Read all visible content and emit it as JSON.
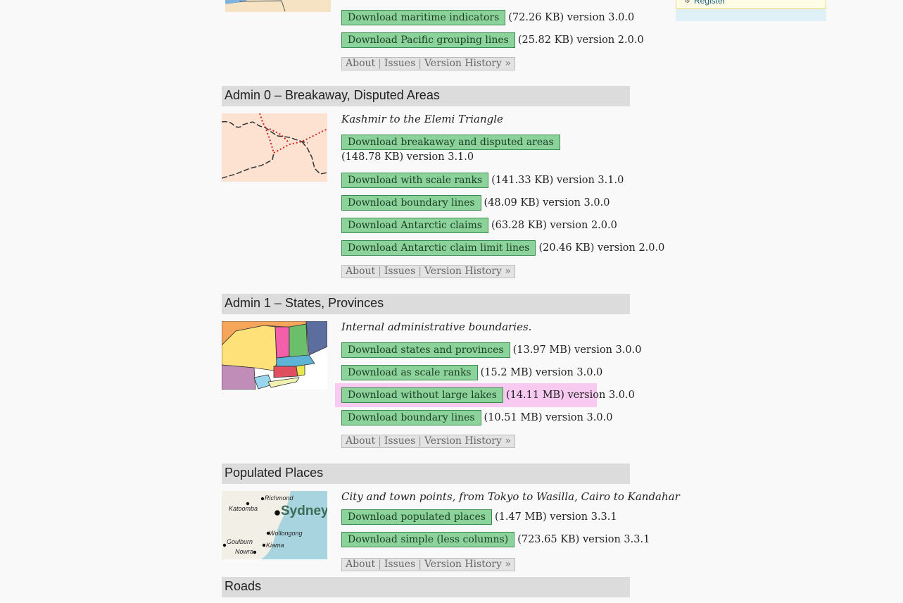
{
  "sidebar": {
    "register_label": "Register"
  },
  "top_block": {
    "rows": [
      {
        "button": "Download maritime indicators",
        "meta": "(72.26 KB) version 3.0.0"
      },
      {
        "button": "Download Pacific grouping lines",
        "meta": "(25.82 KB) version 2.0.0"
      }
    ]
  },
  "links": {
    "about": "About",
    "issues": "Issues",
    "version_history": "Version History »"
  },
  "sections": [
    {
      "title": "Admin 0 – Breakaway, Disputed Areas",
      "description": "Kashmir to the Elemi Triangle",
      "rows": [
        {
          "button": "Download breakaway and disputed areas",
          "meta": "(148.78 KB) version 3.1.0"
        },
        {
          "button": "Download with scale ranks",
          "meta": "(141.33 KB) version 3.1.0"
        },
        {
          "button": "Download boundary lines",
          "meta": "(48.09 KB) version 3.0.0"
        },
        {
          "button": "Download Antarctic claims",
          "meta": "(63.28 KB) version 2.0.0"
        },
        {
          "button": "Download Antarctic claim limit lines",
          "meta": "(20.46 KB) version 2.0.0"
        }
      ]
    },
    {
      "title": "Admin 1 – States, Provinces",
      "description": "Internal administrative boundaries.",
      "rows": [
        {
          "button": "Download states and provinces",
          "meta": "(13.97 MB) version 3.0.0"
        },
        {
          "button": "Download as scale ranks",
          "meta": "(15.2 MB) version 3.0.0"
        },
        {
          "button": "Download without large lakes",
          "meta": "(14.11 MB) version 3.0.0"
        },
        {
          "button": "Download boundary lines",
          "meta": "(10.51 MB) version 3.0.0"
        }
      ]
    },
    {
      "title": "Populated Places",
      "description": "City and town points, from Tokyo to Wasilla, Cairo to Kandahar",
      "rows": [
        {
          "button": "Download populated places",
          "meta": "(1.47 MB) version 3.3.1"
        },
        {
          "button": "Download simple (less columns)",
          "meta": "(723.65 KB) version 3.3.1"
        }
      ]
    },
    {
      "title": "Roads"
    }
  ],
  "map_labels": {
    "richmond": "Richmond",
    "katoomba": "Katoomba",
    "sydney": "Sydney",
    "wollongong": "Wollongong",
    "goulburn": "Goulburn",
    "kiama": "Kiama",
    "nowra": "Nowra"
  },
  "colors": {
    "button_bg": "#8bd39b",
    "highlight": "#f8c9f1",
    "header_bg": "#dcdcdc"
  }
}
